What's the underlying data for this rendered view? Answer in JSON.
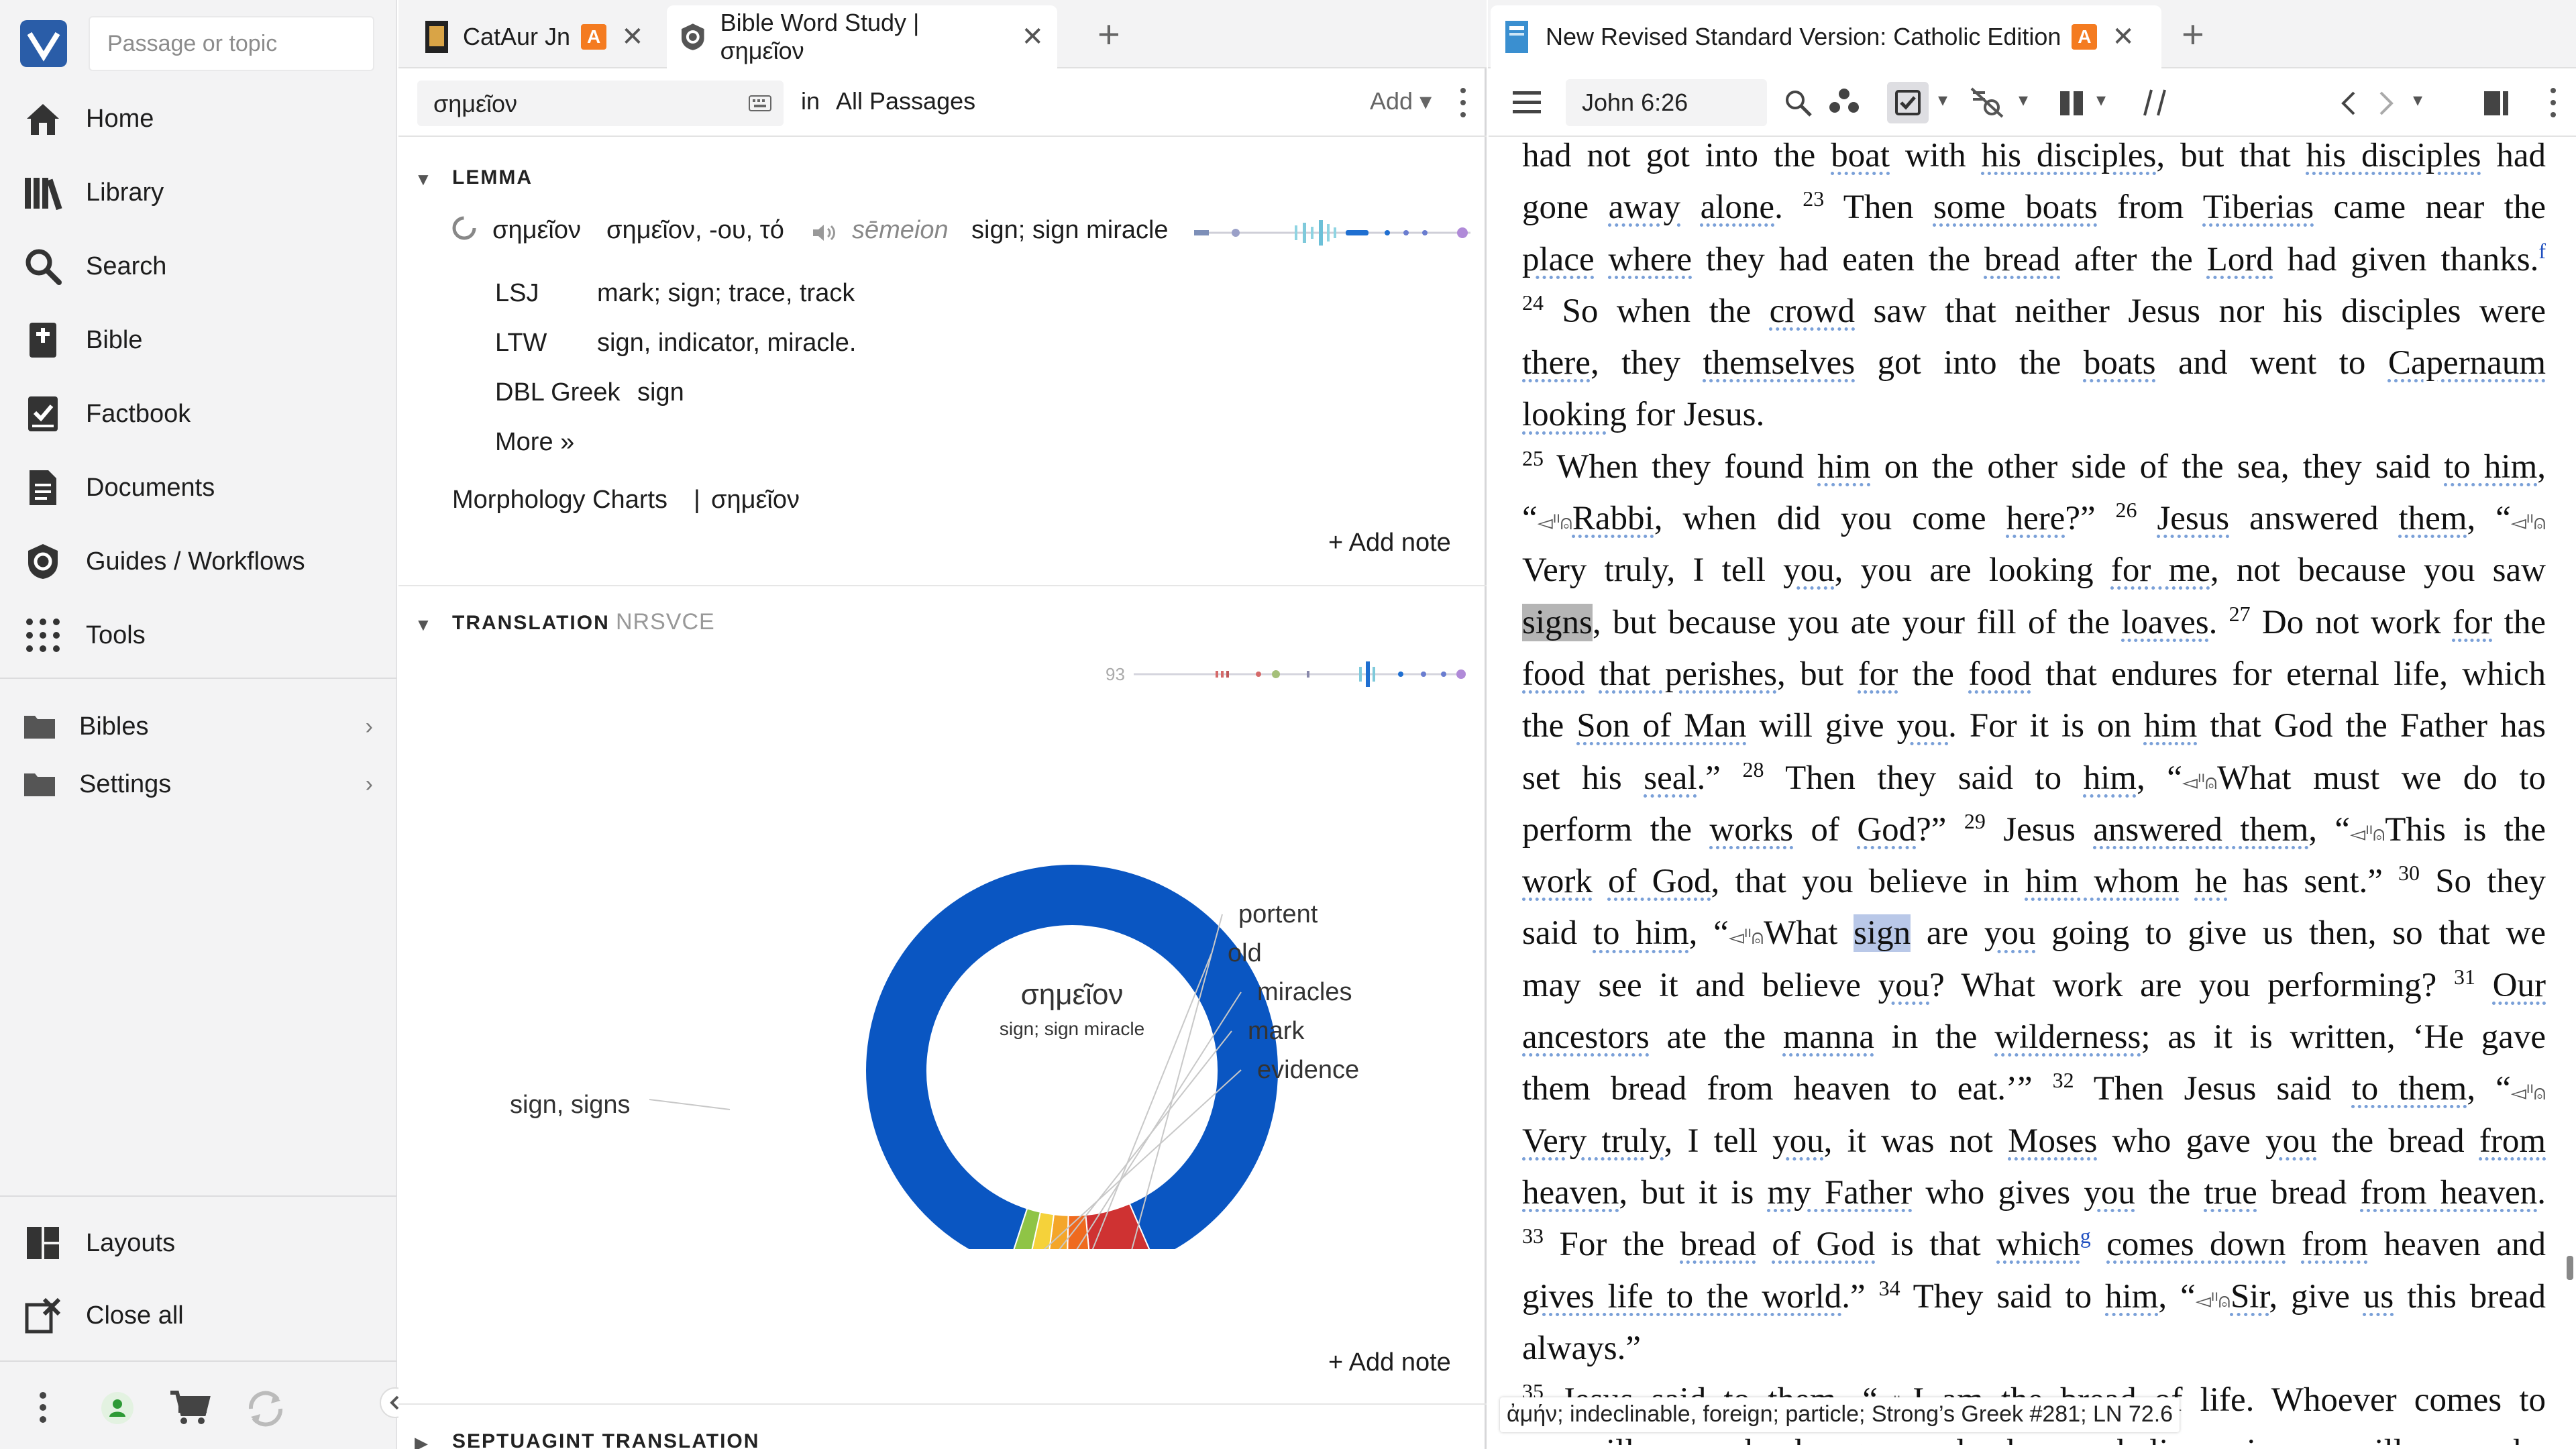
{
  "nav": {
    "search_placeholder": "Passage or topic",
    "items": [
      {
        "label": "Home",
        "icon": "home-icon"
      },
      {
        "label": "Library",
        "icon": "library-icon"
      },
      {
        "label": "Search",
        "icon": "search-icon"
      },
      {
        "label": "Bible",
        "icon": "bible-icon"
      },
      {
        "label": "Factbook",
        "icon": "factbook-icon"
      },
      {
        "label": "Documents",
        "icon": "documents-icon"
      },
      {
        "label": "Guides / Workflows",
        "icon": "guides-icon"
      },
      {
        "label": "Tools",
        "icon": "tools-icon"
      }
    ],
    "folders": [
      {
        "label": "Bibles"
      },
      {
        "label": "Settings"
      }
    ],
    "bottom": [
      {
        "label": "Layouts"
      },
      {
        "label": "Close all"
      }
    ]
  },
  "tabs_left": [
    {
      "label": "CatAur Jn",
      "badge": "A"
    },
    {
      "label": "Bible Word Study | σημεῖον"
    }
  ],
  "tabs_right": [
    {
      "label": "New Revised Standard Version: Catholic Edition",
      "badge": "A"
    }
  ],
  "word_study": {
    "query": "σημεῖον",
    "in_label": "in",
    "scope": "All Passages",
    "add_label": "Add",
    "lemma": {
      "heading": "LEMMA",
      "word": "σημεῖον",
      "forms": "σημεῖον, -ου, τό",
      "translit": "sēmeion",
      "gloss": "sign; sign miracle",
      "defs": [
        {
          "source": "LSJ",
          "text": "mark; sign; trace, track"
        },
        {
          "source": "LTW",
          "text": "sign, indicator, miracle."
        },
        {
          "source": "DBL Greek",
          "text": "sign"
        }
      ],
      "more": "More »",
      "morph_link": "Morphology Charts",
      "morph_word": "σημεῖον",
      "add_note": "+ Add note"
    },
    "translation": {
      "heading": "TRANSLATION",
      "version": "NRSVCE",
      "count": "93",
      "center_word": "σημεῖον",
      "center_gloss": "sign; sign miracle",
      "add_note": "+ Add note"
    },
    "septuagint_heading": "SEPTUAGINT TRANSLATION"
  },
  "chart_data": {
    "type": "pie",
    "categories": [
      "sign, signs",
      "portent",
      "old",
      "miracles",
      "mark",
      "evidence"
    ],
    "values": [
      88.5,
      5.0,
      1.9,
      1.6,
      1.5,
      1.5
    ],
    "colors": [
      "#0a56c2",
      "#cf3232",
      "#ef6a1e",
      "#f4a62a",
      "#f5d23a",
      "#8fc446"
    ]
  },
  "bible": {
    "reference": "John 6:26",
    "lines": [
      [
        {
          "t": "had not got into the "
        },
        {
          "t": "boat",
          "u": 1
        },
        {
          "t": " with "
        },
        {
          "t": "his disciples",
          "u": 1
        },
        {
          "t": ", but that "
        },
        {
          "t": "his disciples",
          "u": 1
        },
        {
          "t": " had"
        }
      ],
      [
        {
          "t": "gone "
        },
        {
          "t": "away",
          "u": 1
        },
        {
          "t": " "
        },
        {
          "t": "alone",
          "u": 1
        },
        {
          "t": ". "
        },
        {
          "v": "23"
        },
        {
          "t": " Then "
        },
        {
          "t": "some boats",
          "u": 1
        },
        {
          "t": " from "
        },
        {
          "t": "Tiberias",
          "u": 1
        },
        {
          "t": " came near the"
        }
      ],
      [
        {
          "t": "place",
          "u": 1
        },
        {
          "t": " "
        },
        {
          "t": "where",
          "u": 1
        },
        {
          "t": " they had eaten the "
        },
        {
          "t": "bread",
          "u": 1
        },
        {
          "t": " after the "
        },
        {
          "t": "Lord",
          "u": 1
        },
        {
          "t": " had given thanks."
        },
        {
          "fn": "f"
        }
      ],
      [
        {
          "v": "24"
        },
        {
          "t": " So when the "
        },
        {
          "t": "crowd",
          "u": 1
        },
        {
          "t": " saw that neither Jesus nor his disciples were"
        }
      ],
      [
        {
          "t": "there",
          "u": 1
        },
        {
          "t": ", they "
        },
        {
          "t": "themselves",
          "u": 1
        },
        {
          "t": " got into the "
        },
        {
          "t": "boats",
          "u": 1
        },
        {
          "t": " and went to "
        },
        {
          "t": "Capernaum",
          "u": 1
        }
      ],
      [
        {
          "t": "looking",
          "u": 1
        },
        {
          "t": " for Jesus."
        }
      ],
      [
        {
          "v": "25"
        },
        {
          "t": " When they found "
        },
        {
          "t": "him",
          "u": 1
        },
        {
          "t": " on the other side of the sea, they said "
        },
        {
          "t": "to him",
          "u": 1
        },
        {
          "t": ","
        }
      ],
      [
        {
          "t": "“"
        },
        {
          "sp": "⸢ ⸣"
        },
        {
          "t": "Rabbi",
          "u": 1
        },
        {
          "t": ", when did you come "
        },
        {
          "t": "here",
          "u": 1
        },
        {
          "t": "?” "
        },
        {
          "v": "26"
        },
        {
          "t": " "
        },
        {
          "t": "Jesus",
          "u": 1
        },
        {
          "t": " answered "
        },
        {
          "t": "them",
          "u": 1
        },
        {
          "t": ", “"
        },
        {
          "sp": "⸢ ⸣"
        }
      ],
      [
        {
          "t": "Very truly, I tell "
        },
        {
          "t": "you",
          "u": 1
        },
        {
          "t": ", you are looking "
        },
        {
          "t": "for me",
          "u": 1
        },
        {
          "t": ", not because you saw"
        }
      ],
      [
        {
          "t": "signs",
          "hl": "gray"
        },
        {
          "t": ", but because you ate your fill of the "
        },
        {
          "t": "loaves",
          "u": 1
        },
        {
          "t": ". "
        },
        {
          "v": "27"
        },
        {
          "t": " Do not work "
        },
        {
          "t": "for",
          "u": 1
        },
        {
          "t": " the"
        }
      ],
      [
        {
          "t": "food",
          "u": 1
        },
        {
          "t": " "
        },
        {
          "t": "that perishes",
          "u": 1
        },
        {
          "t": ", but "
        },
        {
          "t": "for",
          "u": 1
        },
        {
          "t": " the "
        },
        {
          "t": "food",
          "u": 1
        },
        {
          "t": " that endures for eternal life, which"
        }
      ],
      [
        {
          "t": "the "
        },
        {
          "t": "Son of Man",
          "u": 1
        },
        {
          "t": " will give "
        },
        {
          "t": "you",
          "u": 1
        },
        {
          "t": ". For it is on "
        },
        {
          "t": "him",
          "u": 1
        },
        {
          "t": " that God the Father has"
        }
      ],
      [
        {
          "t": "set his "
        },
        {
          "t": "seal",
          "u": 1
        },
        {
          "t": ".” "
        },
        {
          "v": "28"
        },
        {
          "t": " Then they said to "
        },
        {
          "t": "him",
          "u": 1
        },
        {
          "t": ", “"
        },
        {
          "sp": "⸢ ⸣"
        },
        {
          "t": "What must we do to"
        }
      ],
      [
        {
          "t": "perform the "
        },
        {
          "t": "works",
          "u": 1
        },
        {
          "t": " of "
        },
        {
          "t": "God",
          "u": 1
        },
        {
          "t": "?” "
        },
        {
          "v": "29"
        },
        {
          "t": " Jesus "
        },
        {
          "t": "answered them",
          "u": 1
        },
        {
          "t": ", “"
        },
        {
          "sp": "⸢ ⸣"
        },
        {
          "t": "This is the"
        }
      ],
      [
        {
          "t": "work",
          "u": 1
        },
        {
          "t": " "
        },
        {
          "t": "of God",
          "u": 1
        },
        {
          "t": ", that you believe in "
        },
        {
          "t": "him whom",
          "u": 1
        },
        {
          "t": " "
        },
        {
          "t": "he",
          "u": 1
        },
        {
          "t": " has sent.” "
        },
        {
          "v": "30"
        },
        {
          "t": " So they"
        }
      ],
      [
        {
          "t": "said "
        },
        {
          "t": "to him",
          "u": 1
        },
        {
          "t": ", “"
        },
        {
          "sp": "⸢ ⸣"
        },
        {
          "t": "What "
        },
        {
          "t": "sign",
          "hl": "blue"
        },
        {
          "t": " are "
        },
        {
          "t": "you",
          "u": 1
        },
        {
          "t": " going to give us then, so that we"
        }
      ],
      [
        {
          "t": "may see it and believe "
        },
        {
          "t": "you",
          "u": 1
        },
        {
          "t": "? What work are you performing? "
        },
        {
          "v": "31"
        },
        {
          "t": " "
        },
        {
          "t": "Our",
          "u": 1
        }
      ],
      [
        {
          "t": "ancestors",
          "u": 1
        },
        {
          "t": " ate the "
        },
        {
          "t": "manna",
          "u": 1
        },
        {
          "t": " in the "
        },
        {
          "t": "wilderness",
          "u": 1
        },
        {
          "t": "; as it is written, ‘He gave"
        }
      ],
      [
        {
          "t": "them bread from heaven to eat.’” "
        },
        {
          "v": "32"
        },
        {
          "t": " Then Jesus said "
        },
        {
          "t": "to them",
          "u": 1
        },
        {
          "t": ", “"
        },
        {
          "sp": "⸢ ⸣"
        }
      ],
      [
        {
          "t": "Very truly",
          "u": 1
        },
        {
          "t": ", I tell "
        },
        {
          "t": "you",
          "u": 1
        },
        {
          "t": ", it was not "
        },
        {
          "t": "Moses",
          "u": 1
        },
        {
          "t": " who gave "
        },
        {
          "t": "you",
          "u": 1
        },
        {
          "t": " the bread "
        },
        {
          "t": "from",
          "u": 1
        }
      ],
      [
        {
          "t": "heaven",
          "u": 1
        },
        {
          "t": ", but it is "
        },
        {
          "t": "my Father",
          "u": 1
        },
        {
          "t": " who gives "
        },
        {
          "t": "you",
          "u": 1
        },
        {
          "t": " the "
        },
        {
          "t": "true",
          "u": 1
        },
        {
          "t": " bread "
        },
        {
          "t": "from heaven",
          "u": 1
        },
        {
          "t": "."
        }
      ],
      [
        {
          "v": "33"
        },
        {
          "t": " For the "
        },
        {
          "t": "bread",
          "u": 1
        },
        {
          "t": " "
        },
        {
          "t": "of God",
          "u": 1
        },
        {
          "t": " is that "
        },
        {
          "t": "which",
          "u": 1
        },
        {
          "fn": "g"
        },
        {
          "t": " "
        },
        {
          "t": "comes down",
          "u": 1
        },
        {
          "t": " "
        },
        {
          "t": "from",
          "u": 1
        },
        {
          "t": " heaven and"
        }
      ],
      [
        {
          "t": "gives life to the world",
          "u": 1
        },
        {
          "t": ".” "
        },
        {
          "v": "34"
        },
        {
          "t": " They said to "
        },
        {
          "t": "him",
          "u": 1
        },
        {
          "t": ", “"
        },
        {
          "sp": "⸢ ⸣"
        },
        {
          "t": "Sir",
          "u": 1
        },
        {
          "t": ", give "
        },
        {
          "t": "us",
          "u": 1
        },
        {
          "t": " this bread"
        }
      ],
      [
        {
          "t": "always.”"
        }
      ],
      [
        {
          "v": "35"
        },
        {
          "t": " Jesus said to them, “"
        },
        {
          "sp": "⸢ ⸣"
        },
        {
          "t": "I am the bread of life. Whoever comes to"
        }
      ],
      [
        {
          "t": "me will never be hungry, and whoever believes in me will never be"
        }
      ]
    ],
    "tooltip": "ἀμήν; indeclinable, foreign; particle; Strong’s Greek #281; LN 72.6"
  }
}
